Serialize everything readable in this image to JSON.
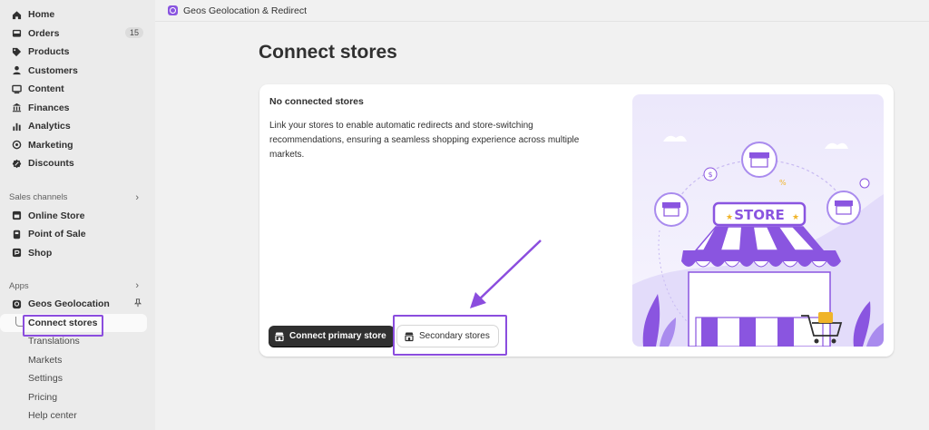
{
  "colors": {
    "accent": "#8b4dde",
    "sidebar_bg": "#ebebeb",
    "page_bg": "#f1f1f1",
    "primary_button": "#303030"
  },
  "sidebar": {
    "main_items": [
      {
        "label": "Home",
        "icon": "home-icon"
      },
      {
        "label": "Orders",
        "icon": "orders-icon",
        "badge": "15"
      },
      {
        "label": "Products",
        "icon": "tag-icon"
      },
      {
        "label": "Customers",
        "icon": "person-icon"
      },
      {
        "label": "Content",
        "icon": "content-icon"
      },
      {
        "label": "Finances",
        "icon": "bank-icon"
      },
      {
        "label": "Analytics",
        "icon": "bar-chart-icon"
      },
      {
        "label": "Marketing",
        "icon": "target-icon"
      },
      {
        "label": "Discounts",
        "icon": "discount-icon"
      }
    ],
    "sales_channels": {
      "heading": "Sales channels",
      "items": [
        {
          "label": "Online Store",
          "icon": "online-store-icon"
        },
        {
          "label": "Point of Sale",
          "icon": "pos-icon"
        },
        {
          "label": "Shop",
          "icon": "shop-icon"
        }
      ]
    },
    "apps": {
      "heading": "Apps",
      "app_label": "Geos Geolocation",
      "sub_items": [
        "Connect stores",
        "Translations",
        "Markets",
        "Settings",
        "Pricing",
        "Help center"
      ]
    }
  },
  "topbar": {
    "app_name": "Geos Geolocation & Redirect"
  },
  "page": {
    "title": "Connect stores",
    "card": {
      "title": "No connected stores",
      "description": "Link your stores to enable automatic redirects and store-switching recommendations, ensuring a seamless shopping experience across multiple markets.",
      "primary_button": "Connect primary store",
      "secondary_button": "Secondary stores",
      "illustration_text": "STORE"
    }
  }
}
